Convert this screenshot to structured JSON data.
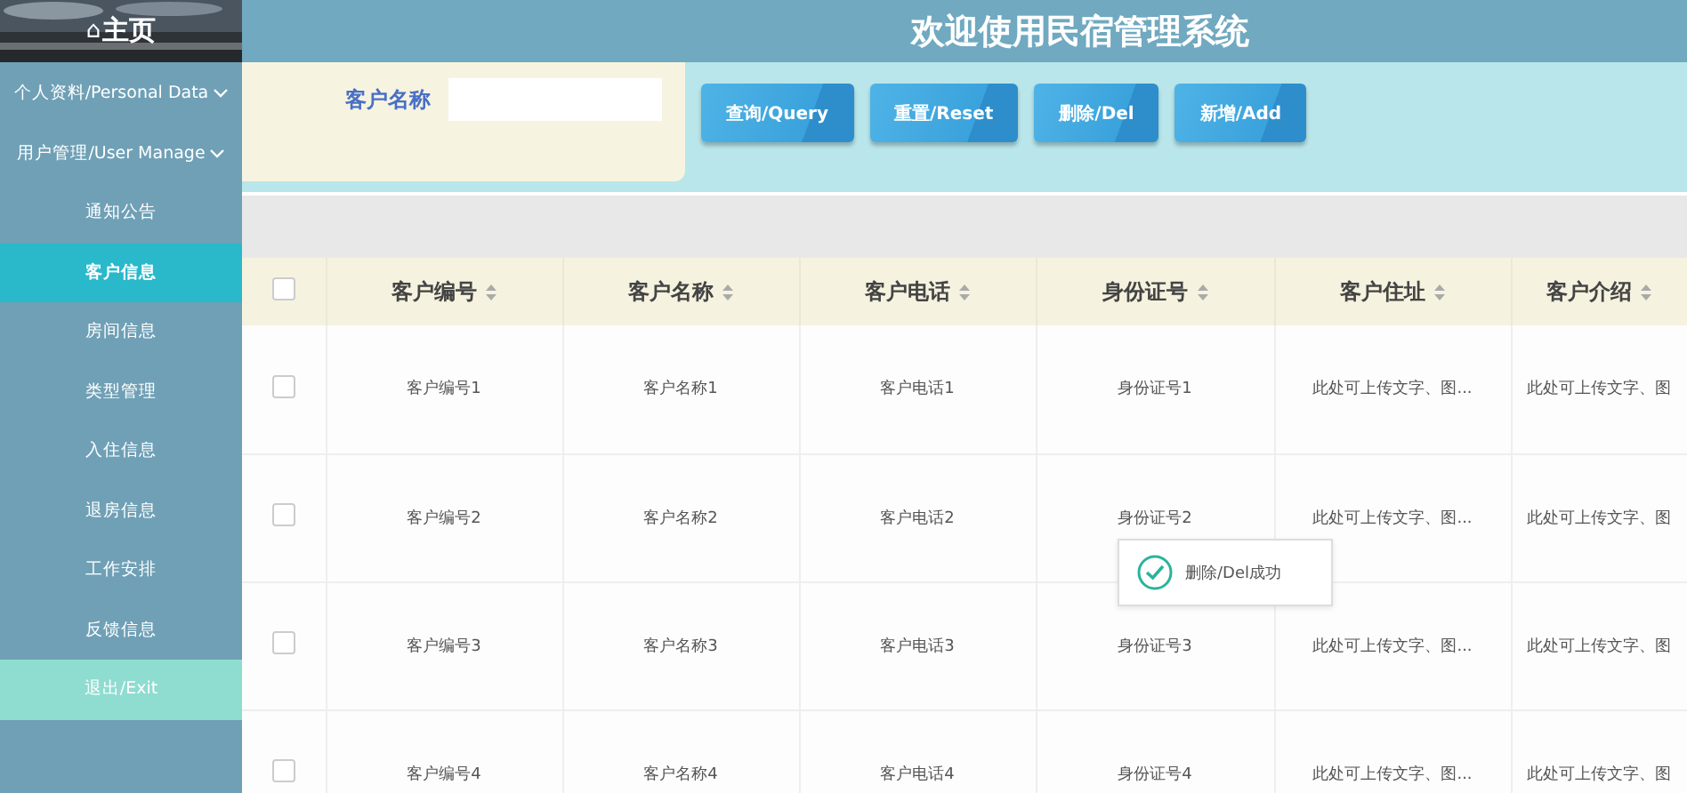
{
  "brand": {
    "home_icon": "⌂",
    "title": "主页"
  },
  "sidebar": {
    "menus": [
      {
        "label": "个人资料/Personal Data"
      },
      {
        "label": "用户管理/User Manage"
      }
    ],
    "items": [
      {
        "label": "通知公告",
        "kind": "link",
        "selected": false
      },
      {
        "label": "客户信息",
        "kind": "link",
        "selected": true
      },
      {
        "label": "房间信息",
        "kind": "link",
        "selected": false
      },
      {
        "label": "类型管理",
        "kind": "link",
        "selected": false
      },
      {
        "label": "入住信息",
        "kind": "link",
        "selected": false
      },
      {
        "label": "退房信息",
        "kind": "link",
        "selected": false
      },
      {
        "label": "工作安排",
        "kind": "link",
        "selected": false
      },
      {
        "label": "反馈信息",
        "kind": "link",
        "selected": false
      },
      {
        "label": "退出/Exit",
        "kind": "exit",
        "selected": false
      }
    ]
  },
  "header": {
    "title": "欢迎使用民宿管理系统"
  },
  "search": {
    "label": "客户名称"
  },
  "buttons": [
    "查询/Query",
    "重置/Reset",
    "删除/Del",
    "新增/Add"
  ],
  "table": {
    "all_checked": false,
    "columns": [
      "客户编号",
      "客户名称",
      "客户电话",
      "身份证号",
      "客户住址",
      "客户介绍"
    ],
    "rows": [
      {
        "checked": false,
        "cells": [
          "客户编号1",
          "客户名称1",
          "客户电话1",
          "身份证号1",
          "此处可上传文字、图...",
          "此处可上传文字、图"
        ]
      },
      {
        "checked": false,
        "cells": [
          "客户编号2",
          "客户名称2",
          "客户电话2",
          "身份证号2",
          "此处可上传文字、图...",
          "此处可上传文字、图"
        ]
      },
      {
        "checked": false,
        "cells": [
          "客户编号3",
          "客户名称3",
          "客户电话3",
          "身份证号3",
          "此处可上传文字、图...",
          "此处可上传文字、图"
        ]
      },
      {
        "checked": false,
        "cells": [
          "客户编号4",
          "客户名称4",
          "客户电话4",
          "身份证号4",
          "此处可上传文字、图...",
          "此处可上传文字、图"
        ]
      }
    ]
  },
  "toast": {
    "kind": "success",
    "text": "删除/Del成功"
  }
}
